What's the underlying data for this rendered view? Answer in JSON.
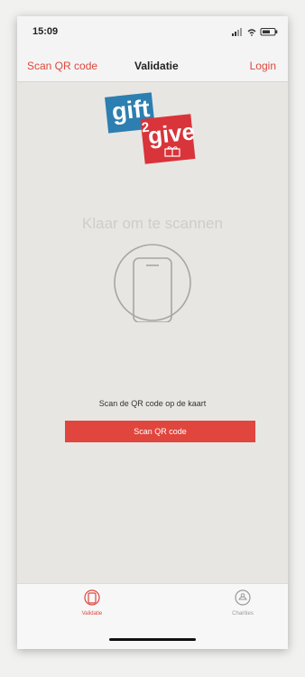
{
  "status_bar": {
    "time": "15:09"
  },
  "nav": {
    "back_label": "Scan QR code",
    "title": "Validatie",
    "login_label": "Login"
  },
  "logo": {
    "part1": "gift",
    "part2": "2",
    "part3": "give"
  },
  "main": {
    "tap_hint": "Klaar om te scannen",
    "instruction": "Scan de QR code op de kaart",
    "scan_button_label": "Scan QR code"
  },
  "tab_bar": {
    "tabs": [
      {
        "label": "Validatie",
        "icon": "phone-icon",
        "active": true
      },
      {
        "label": "Charities",
        "icon": "charity-icon",
        "active": false
      }
    ]
  },
  "colors": {
    "accent": "#e0463d",
    "background": "#e8e6e2",
    "logo_blue": "#2c7fb0",
    "logo_red": "#d9343a"
  }
}
